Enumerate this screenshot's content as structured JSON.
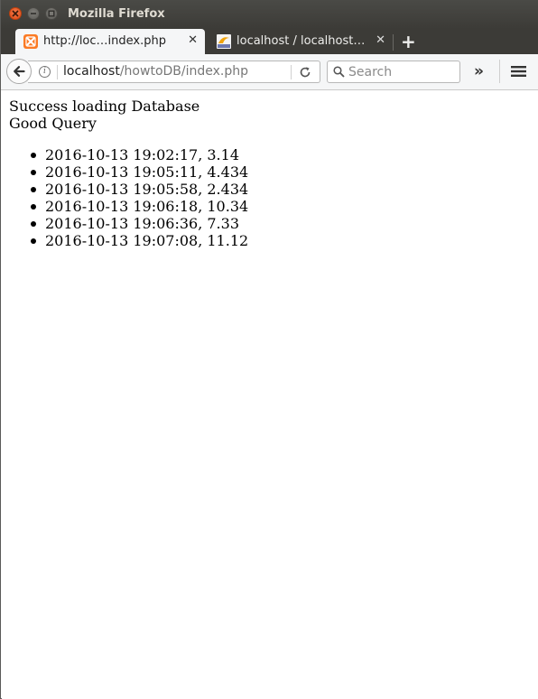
{
  "window": {
    "title": "Mozilla Firefox"
  },
  "tabs": [
    {
      "label": "http://loc…index.php",
      "favicon": "xampp-icon",
      "active": true
    },
    {
      "label": "localhost / localhost…",
      "favicon": "phpmyadmin-icon",
      "active": false
    }
  ],
  "toolbar": {
    "url_host": "localhost",
    "url_path": "/howtoDB/index.php",
    "search_placeholder": "Search"
  },
  "page": {
    "status_line": "Success loading Database",
    "query_line": "Good Query",
    "records": [
      "2016-10-13 19:02:17, 3.14",
      "2016-10-13 19:05:11, 4.434",
      "2016-10-13 19:05:58, 2.434",
      "2016-10-13 19:06:18, 10.34",
      "2016-10-13 19:06:36, 7.33",
      "2016-10-13 19:07:08, 11.12"
    ]
  },
  "colors": {
    "titlebar": "#3c3b37",
    "close_button": "#dd4814",
    "toolbar": "#f5f6f7"
  }
}
